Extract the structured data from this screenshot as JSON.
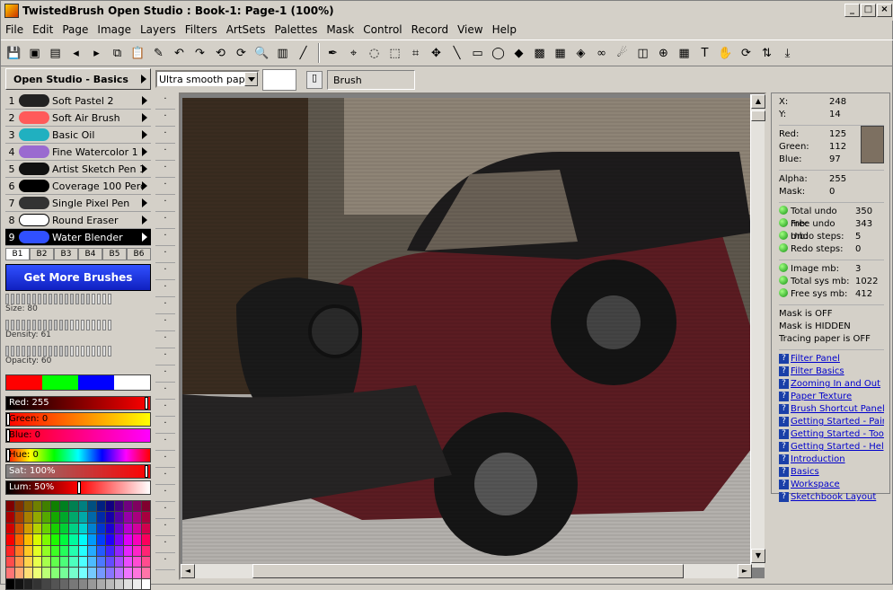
{
  "window": {
    "title": "TwistedBrush Open Studio : Book-1: Page-1 (100%)",
    "buttons": [
      "_",
      "□",
      "×"
    ]
  },
  "menu": [
    "File",
    "Edit",
    "Page",
    "Image",
    "Layers",
    "Filters",
    "ArtSets",
    "Palettes",
    "Mask",
    "Control",
    "Record",
    "View",
    "Help"
  ],
  "toolbar_icons": [
    "save-icon",
    "save-as-icon",
    "page-icon",
    "prev-page-icon",
    "next-page-icon",
    "copy-icon",
    "paste-icon",
    "brush-icon",
    "undo-icon",
    "redo-icon",
    "undo-all-icon",
    "redo-all-icon",
    "zoom-icon",
    "levels-icon",
    "stroke-icon",
    "pen-icon",
    "eyedropper-icon",
    "bucket-icon",
    "select-icon",
    "crop-icon",
    "move-icon",
    "line-icon",
    "rect-icon",
    "ellipse-icon",
    "fill-icon",
    "texture-icon",
    "pattern-icon",
    "blend-icon",
    "lasso-icon",
    "smudge-icon",
    "layer-icon",
    "clone-icon",
    "grid-icon",
    "text-icon",
    "hand-icon",
    "rotate-icon",
    "flip-icon",
    "export-icon"
  ],
  "preset": {
    "label": "Open Studio - Basics"
  },
  "paper": {
    "value": "Ultra smooth paper"
  },
  "brush_label": "Brush",
  "brushes": [
    {
      "n": "1",
      "name": "Soft Pastel 2",
      "color": "#222"
    },
    {
      "n": "2",
      "name": "Soft Air Brush",
      "color": "#ff5a5a"
    },
    {
      "n": "3",
      "name": "Basic Oil",
      "color": "#20b0c0"
    },
    {
      "n": "4",
      "name": "Fine Watercolor 1",
      "color": "#9a6ad0"
    },
    {
      "n": "5",
      "name": "Artist Sketch Pen 1",
      "color": "#111"
    },
    {
      "n": "6",
      "name": "Coverage 100 Percent",
      "color": "#000"
    },
    {
      "n": "7",
      "name": "Single Pixel Pen",
      "color": "#333"
    },
    {
      "n": "8",
      "name": "Round Eraser",
      "color": "#fff"
    },
    {
      "n": "9",
      "name": "Water Blender",
      "color": "#3050ff"
    }
  ],
  "brush_tabs": [
    "B1",
    "B2",
    "B3",
    "B4",
    "B5",
    "B6"
  ],
  "get_more": "Get More Brushes",
  "sliders": [
    {
      "label": "Size: 80",
      "level": 0.8
    },
    {
      "label": "Density: 61",
      "level": 0.61
    },
    {
      "label": "Opacity: 60",
      "level": 0.6
    }
  ],
  "colors": {
    "primary_swatches": [
      "#ff0000",
      "#00ff00",
      "#0000ff",
      "#ffffff"
    ]
  },
  "channels": [
    {
      "label": "Red: 255",
      "value": 255
    },
    {
      "label": "Green: 0",
      "value": 0
    },
    {
      "label": "Blue: 0",
      "value": 0
    },
    {
      "label": "Hue: 0",
      "value": 0
    },
    {
      "label": "Sat: 100%",
      "value": 100
    },
    {
      "label": "Lum: 50%",
      "value": 50
    }
  ],
  "info": {
    "x": {
      "k": "X:",
      "v": "248"
    },
    "y": {
      "k": "Y:",
      "v": "14"
    },
    "red": {
      "k": "Red:",
      "v": "125"
    },
    "green": {
      "k": "Green:",
      "v": "112"
    },
    "blue": {
      "k": "Blue:",
      "v": "97"
    },
    "alpha": {
      "k": "Alpha:",
      "v": "255"
    },
    "mask": {
      "k": "Mask:",
      "v": "0"
    },
    "pixel_color": "#7d7061",
    "mem": [
      {
        "k": "Total undo mb:",
        "v": "350"
      },
      {
        "k": "Free undo mb:",
        "v": "343"
      },
      {
        "k": "Undo steps:",
        "v": "5"
      },
      {
        "k": "Redo steps:",
        "v": "0"
      }
    ],
    "sys": [
      {
        "k": "Image mb:",
        "v": "3"
      },
      {
        "k": "Total sys mb:",
        "v": "1022"
      },
      {
        "k": "Free sys mb:",
        "v": "412"
      }
    ],
    "status": [
      "Mask is OFF",
      "Mask is HIDDEN",
      "Tracing paper is OFF"
    ],
    "links": [
      "Filter Panel",
      "Filter Basics",
      "Zooming In and Out",
      "Paper Texture",
      "Brush Shortcut Panel",
      "Getting Started - Painting",
      "Getting Started - Tools",
      "Getting Started - Help",
      "Introduction",
      "Basics",
      "Workspace",
      "Sketchbook Layout"
    ]
  }
}
